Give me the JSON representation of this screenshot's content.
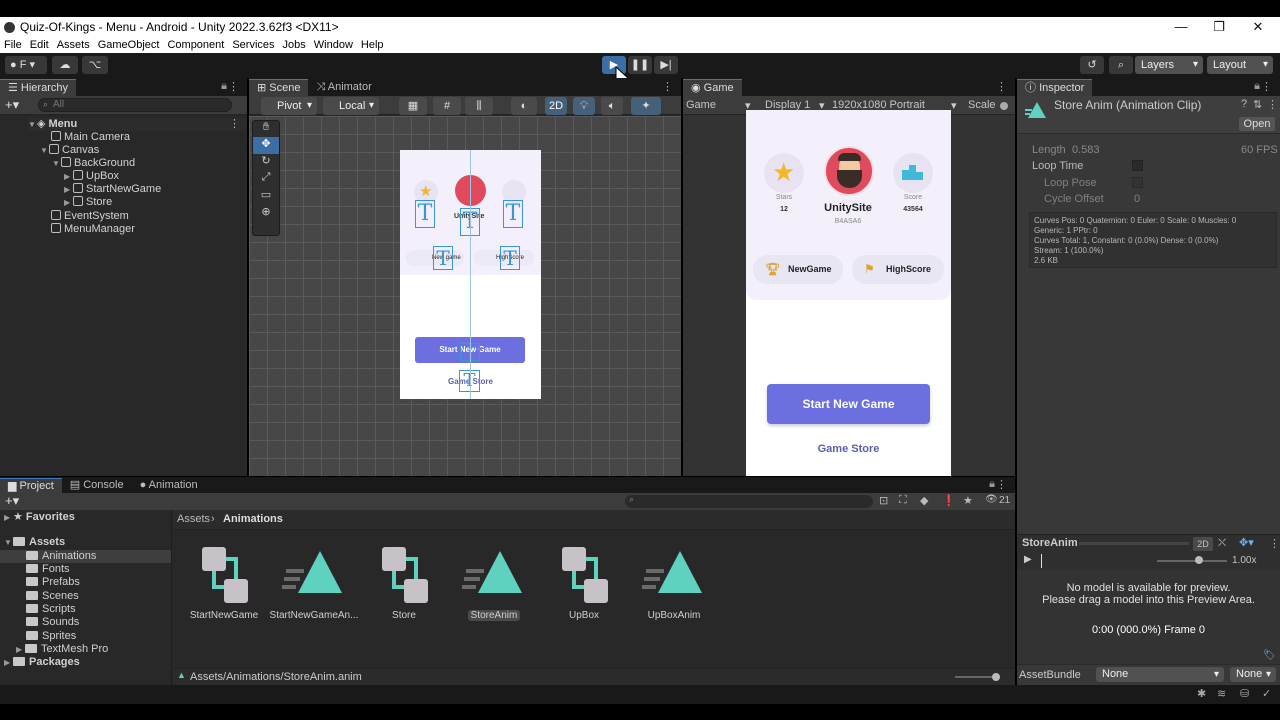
{
  "window": {
    "title": "Quiz-Of-Kings - Menu - Android - Unity 2022.3.62f3 <DX11>",
    "minimize": "—",
    "restore": "❐",
    "close": "✕"
  },
  "menu": [
    "File",
    "Edit",
    "Assets",
    "GameObject",
    "Component",
    "Services",
    "Jobs",
    "Window",
    "Help"
  ],
  "toolbar": {
    "account": "F",
    "layers": "Layers",
    "layout": "Layout"
  },
  "hierarchy": {
    "tab": "Hierarchy",
    "search_placeholder": "All",
    "items": [
      {
        "label": "Menu"
      },
      {
        "label": "Main Camera"
      },
      {
        "label": "Canvas"
      },
      {
        "label": "BackGround"
      },
      {
        "label": "UpBox"
      },
      {
        "label": "StartNewGame"
      },
      {
        "label": "Store"
      },
      {
        "label": "EventSystem"
      },
      {
        "label": "MenuManager"
      }
    ]
  },
  "scene": {
    "tabs": [
      "Scene",
      "Animator"
    ],
    "pivot": "Pivot",
    "local": "Local",
    "mode_2d": "2D",
    "preview": {
      "name": "UnitySite",
      "new_game": "New game",
      "highscore": "HighScore",
      "start": "Start New Game",
      "store": "Game Store"
    }
  },
  "game": {
    "tab": "Game",
    "mode": "Game",
    "display": "Display 1",
    "resolution": "1920x1080 Portrait",
    "scale_label": "Scale",
    "stars_label": "Stars",
    "stars_value": "12",
    "score_label": "Score",
    "score_value": "43564",
    "username": "UnitySite",
    "user_code": "B4ASA6",
    "new_game": "NewGame",
    "highscore": "HighScore",
    "start_button": "Start New Game",
    "store_link": "Game Store"
  },
  "inspector": {
    "tab": "Inspector",
    "asset_title": "Store Anim (Animation Clip)",
    "open_button": "Open",
    "length_label": "Length",
    "length_value": "0.583",
    "fps": "60 FPS",
    "loop_time": "Loop Time",
    "loop_pose": "Loop Pose",
    "cycle_offset": "Cycle Offset",
    "cycle_offset_value": "0",
    "stats": [
      "Curves Pos: 0 Quaternion: 0 Euler: 0 Scale: 0 Muscles: 0",
      "Generic: 1 PPtr: 0",
      "Curves Total: 1, Constant: 0 (0.0%) Dense: 0 (0.0%)",
      "Stream: 1 (100.0%)",
      "2.6 KB"
    ],
    "preview_title": "StoreAnim",
    "preview_2d": "2D",
    "preview_speed": "1.00x",
    "no_model_1": "No model is available for preview.",
    "no_model_2": "Please drag a model into this Preview Area.",
    "frame_info": "0:00 (000.0%) Frame 0",
    "assetbundle_label": "AssetBundle",
    "assetbundle_value": "None",
    "assetbundle_variant": "None"
  },
  "project": {
    "tabs": [
      "Project",
      "Console",
      "Animation"
    ],
    "favorites": "Favorites",
    "assets": "Assets",
    "folders": [
      "Animations",
      "Fonts",
      "Prefabs",
      "Scenes",
      "Scripts",
      "Sounds",
      "Sprites",
      "TextMesh Pro"
    ],
    "packages": "Packages",
    "breadcrumb_root": "Assets",
    "breadcrumb_current": "Animations",
    "visible_count": "21",
    "items": [
      {
        "label": "StartNewGame",
        "kind": "controller"
      },
      {
        "label": "StartNewGameAn...",
        "kind": "clip"
      },
      {
        "label": "Store",
        "kind": "controller"
      },
      {
        "label": "StoreAnim",
        "kind": "clip"
      },
      {
        "label": "UpBox",
        "kind": "controller"
      },
      {
        "label": "UpBoxAnim",
        "kind": "clip"
      }
    ],
    "selected_path": "Assets/Animations/StoreAnim.anim"
  },
  "colors": {
    "accent_blue": "#3a79bb",
    "clip_teal": "#5fd1bf",
    "button_purple": "#6b6fe0",
    "link_purple": "#5a5fa8"
  }
}
